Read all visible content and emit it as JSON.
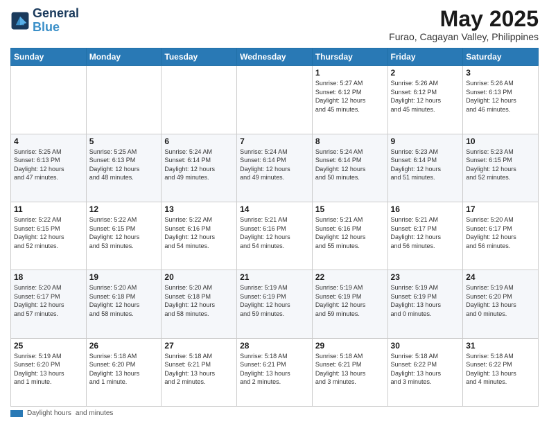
{
  "logo": {
    "line1": "General",
    "line2": "Blue"
  },
  "title": "May 2025",
  "subtitle": "Furao, Cagayan Valley, Philippines",
  "weekdays": [
    "Sunday",
    "Monday",
    "Tuesday",
    "Wednesday",
    "Thursday",
    "Friday",
    "Saturday"
  ],
  "weeks": [
    [
      {
        "day": "",
        "info": ""
      },
      {
        "day": "",
        "info": ""
      },
      {
        "day": "",
        "info": ""
      },
      {
        "day": "",
        "info": ""
      },
      {
        "day": "1",
        "info": "Sunrise: 5:27 AM\nSunset: 6:12 PM\nDaylight: 12 hours\nand 45 minutes."
      },
      {
        "day": "2",
        "info": "Sunrise: 5:26 AM\nSunset: 6:12 PM\nDaylight: 12 hours\nand 45 minutes."
      },
      {
        "day": "3",
        "info": "Sunrise: 5:26 AM\nSunset: 6:13 PM\nDaylight: 12 hours\nand 46 minutes."
      }
    ],
    [
      {
        "day": "4",
        "info": "Sunrise: 5:25 AM\nSunset: 6:13 PM\nDaylight: 12 hours\nand 47 minutes."
      },
      {
        "day": "5",
        "info": "Sunrise: 5:25 AM\nSunset: 6:13 PM\nDaylight: 12 hours\nand 48 minutes."
      },
      {
        "day": "6",
        "info": "Sunrise: 5:24 AM\nSunset: 6:14 PM\nDaylight: 12 hours\nand 49 minutes."
      },
      {
        "day": "7",
        "info": "Sunrise: 5:24 AM\nSunset: 6:14 PM\nDaylight: 12 hours\nand 49 minutes."
      },
      {
        "day": "8",
        "info": "Sunrise: 5:24 AM\nSunset: 6:14 PM\nDaylight: 12 hours\nand 50 minutes."
      },
      {
        "day": "9",
        "info": "Sunrise: 5:23 AM\nSunset: 6:14 PM\nDaylight: 12 hours\nand 51 minutes."
      },
      {
        "day": "10",
        "info": "Sunrise: 5:23 AM\nSunset: 6:15 PM\nDaylight: 12 hours\nand 52 minutes."
      }
    ],
    [
      {
        "day": "11",
        "info": "Sunrise: 5:22 AM\nSunset: 6:15 PM\nDaylight: 12 hours\nand 52 minutes."
      },
      {
        "day": "12",
        "info": "Sunrise: 5:22 AM\nSunset: 6:15 PM\nDaylight: 12 hours\nand 53 minutes."
      },
      {
        "day": "13",
        "info": "Sunrise: 5:22 AM\nSunset: 6:16 PM\nDaylight: 12 hours\nand 54 minutes."
      },
      {
        "day": "14",
        "info": "Sunrise: 5:21 AM\nSunset: 6:16 PM\nDaylight: 12 hours\nand 54 minutes."
      },
      {
        "day": "15",
        "info": "Sunrise: 5:21 AM\nSunset: 6:16 PM\nDaylight: 12 hours\nand 55 minutes."
      },
      {
        "day": "16",
        "info": "Sunrise: 5:21 AM\nSunset: 6:17 PM\nDaylight: 12 hours\nand 56 minutes."
      },
      {
        "day": "17",
        "info": "Sunrise: 5:20 AM\nSunset: 6:17 PM\nDaylight: 12 hours\nand 56 minutes."
      }
    ],
    [
      {
        "day": "18",
        "info": "Sunrise: 5:20 AM\nSunset: 6:17 PM\nDaylight: 12 hours\nand 57 minutes."
      },
      {
        "day": "19",
        "info": "Sunrise: 5:20 AM\nSunset: 6:18 PM\nDaylight: 12 hours\nand 58 minutes."
      },
      {
        "day": "20",
        "info": "Sunrise: 5:20 AM\nSunset: 6:18 PM\nDaylight: 12 hours\nand 58 minutes."
      },
      {
        "day": "21",
        "info": "Sunrise: 5:19 AM\nSunset: 6:19 PM\nDaylight: 12 hours\nand 59 minutes."
      },
      {
        "day": "22",
        "info": "Sunrise: 5:19 AM\nSunset: 6:19 PM\nDaylight: 12 hours\nand 59 minutes."
      },
      {
        "day": "23",
        "info": "Sunrise: 5:19 AM\nSunset: 6:19 PM\nDaylight: 13 hours\nand 0 minutes."
      },
      {
        "day": "24",
        "info": "Sunrise: 5:19 AM\nSunset: 6:20 PM\nDaylight: 13 hours\nand 0 minutes."
      }
    ],
    [
      {
        "day": "25",
        "info": "Sunrise: 5:19 AM\nSunset: 6:20 PM\nDaylight: 13 hours\nand 1 minute."
      },
      {
        "day": "26",
        "info": "Sunrise: 5:18 AM\nSunset: 6:20 PM\nDaylight: 13 hours\nand 1 minute."
      },
      {
        "day": "27",
        "info": "Sunrise: 5:18 AM\nSunset: 6:21 PM\nDaylight: 13 hours\nand 2 minutes."
      },
      {
        "day": "28",
        "info": "Sunrise: 5:18 AM\nSunset: 6:21 PM\nDaylight: 13 hours\nand 2 minutes."
      },
      {
        "day": "29",
        "info": "Sunrise: 5:18 AM\nSunset: 6:21 PM\nDaylight: 13 hours\nand 3 minutes."
      },
      {
        "day": "30",
        "info": "Sunrise: 5:18 AM\nSunset: 6:22 PM\nDaylight: 13 hours\nand 3 minutes."
      },
      {
        "day": "31",
        "info": "Sunrise: 5:18 AM\nSunset: 6:22 PM\nDaylight: 13 hours\nand 4 minutes."
      }
    ]
  ],
  "footer": {
    "label1": "Daylight hours",
    "label2": "and minutes"
  }
}
